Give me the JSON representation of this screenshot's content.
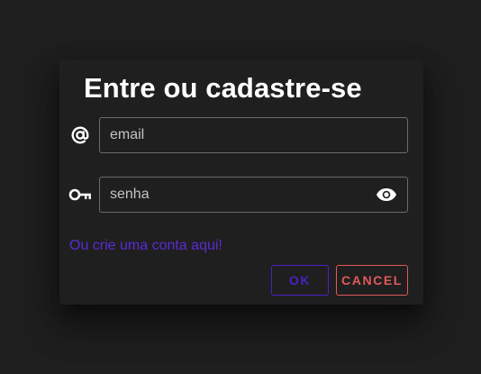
{
  "dialog": {
    "title": "Entre ou cadastre-se",
    "email_field": {
      "icon": "at-sign-icon",
      "placeholder": "email",
      "value": ""
    },
    "password_field": {
      "icon": "key-icon",
      "placeholder": "senha",
      "value": "",
      "toggle_icon": "eye-icon"
    },
    "create_account_link": "Ou crie uma conta aqui!",
    "ok_label": "OK",
    "cancel_label": "CANCEL"
  },
  "colors": {
    "background": "#1f1f1f",
    "accent": "#4a21c4",
    "link": "#5b2bd6",
    "danger": "#e15a5a",
    "text": "#ffffff"
  }
}
